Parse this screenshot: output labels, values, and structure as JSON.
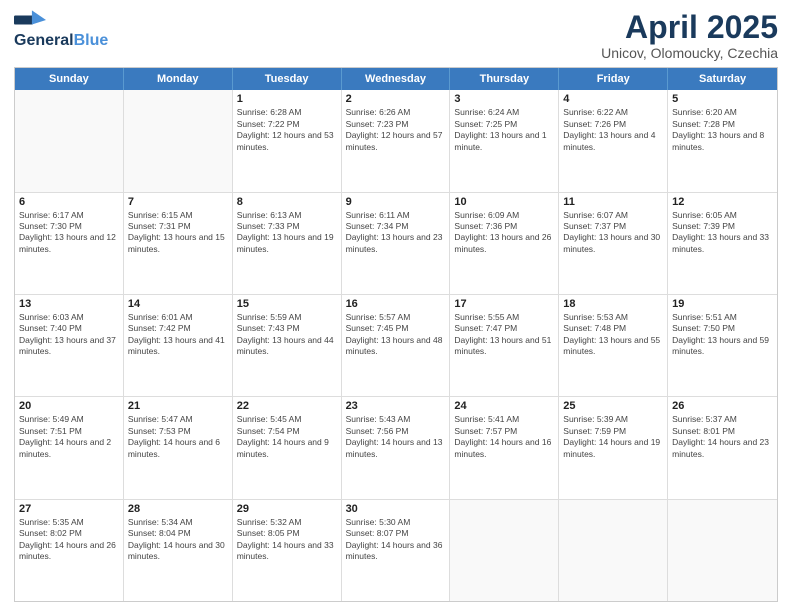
{
  "header": {
    "logo_line1": "General",
    "logo_line2": "Blue",
    "month_year": "April 2025",
    "location": "Unicov, Olomoucky, Czechia"
  },
  "days_of_week": [
    "Sunday",
    "Monday",
    "Tuesday",
    "Wednesday",
    "Thursday",
    "Friday",
    "Saturday"
  ],
  "weeks": [
    [
      {
        "day": "",
        "sunrise": "",
        "sunset": "",
        "daylight": ""
      },
      {
        "day": "",
        "sunrise": "",
        "sunset": "",
        "daylight": ""
      },
      {
        "day": "1",
        "sunrise": "Sunrise: 6:28 AM",
        "sunset": "Sunset: 7:22 PM",
        "daylight": "Daylight: 12 hours and 53 minutes."
      },
      {
        "day": "2",
        "sunrise": "Sunrise: 6:26 AM",
        "sunset": "Sunset: 7:23 PM",
        "daylight": "Daylight: 12 hours and 57 minutes."
      },
      {
        "day": "3",
        "sunrise": "Sunrise: 6:24 AM",
        "sunset": "Sunset: 7:25 PM",
        "daylight": "Daylight: 13 hours and 1 minute."
      },
      {
        "day": "4",
        "sunrise": "Sunrise: 6:22 AM",
        "sunset": "Sunset: 7:26 PM",
        "daylight": "Daylight: 13 hours and 4 minutes."
      },
      {
        "day": "5",
        "sunrise": "Sunrise: 6:20 AM",
        "sunset": "Sunset: 7:28 PM",
        "daylight": "Daylight: 13 hours and 8 minutes."
      }
    ],
    [
      {
        "day": "6",
        "sunrise": "Sunrise: 6:17 AM",
        "sunset": "Sunset: 7:30 PM",
        "daylight": "Daylight: 13 hours and 12 minutes."
      },
      {
        "day": "7",
        "sunrise": "Sunrise: 6:15 AM",
        "sunset": "Sunset: 7:31 PM",
        "daylight": "Daylight: 13 hours and 15 minutes."
      },
      {
        "day": "8",
        "sunrise": "Sunrise: 6:13 AM",
        "sunset": "Sunset: 7:33 PM",
        "daylight": "Daylight: 13 hours and 19 minutes."
      },
      {
        "day": "9",
        "sunrise": "Sunrise: 6:11 AM",
        "sunset": "Sunset: 7:34 PM",
        "daylight": "Daylight: 13 hours and 23 minutes."
      },
      {
        "day": "10",
        "sunrise": "Sunrise: 6:09 AM",
        "sunset": "Sunset: 7:36 PM",
        "daylight": "Daylight: 13 hours and 26 minutes."
      },
      {
        "day": "11",
        "sunrise": "Sunrise: 6:07 AM",
        "sunset": "Sunset: 7:37 PM",
        "daylight": "Daylight: 13 hours and 30 minutes."
      },
      {
        "day": "12",
        "sunrise": "Sunrise: 6:05 AM",
        "sunset": "Sunset: 7:39 PM",
        "daylight": "Daylight: 13 hours and 33 minutes."
      }
    ],
    [
      {
        "day": "13",
        "sunrise": "Sunrise: 6:03 AM",
        "sunset": "Sunset: 7:40 PM",
        "daylight": "Daylight: 13 hours and 37 minutes."
      },
      {
        "day": "14",
        "sunrise": "Sunrise: 6:01 AM",
        "sunset": "Sunset: 7:42 PM",
        "daylight": "Daylight: 13 hours and 41 minutes."
      },
      {
        "day": "15",
        "sunrise": "Sunrise: 5:59 AM",
        "sunset": "Sunset: 7:43 PM",
        "daylight": "Daylight: 13 hours and 44 minutes."
      },
      {
        "day": "16",
        "sunrise": "Sunrise: 5:57 AM",
        "sunset": "Sunset: 7:45 PM",
        "daylight": "Daylight: 13 hours and 48 minutes."
      },
      {
        "day": "17",
        "sunrise": "Sunrise: 5:55 AM",
        "sunset": "Sunset: 7:47 PM",
        "daylight": "Daylight: 13 hours and 51 minutes."
      },
      {
        "day": "18",
        "sunrise": "Sunrise: 5:53 AM",
        "sunset": "Sunset: 7:48 PM",
        "daylight": "Daylight: 13 hours and 55 minutes."
      },
      {
        "day": "19",
        "sunrise": "Sunrise: 5:51 AM",
        "sunset": "Sunset: 7:50 PM",
        "daylight": "Daylight: 13 hours and 59 minutes."
      }
    ],
    [
      {
        "day": "20",
        "sunrise": "Sunrise: 5:49 AM",
        "sunset": "Sunset: 7:51 PM",
        "daylight": "Daylight: 14 hours and 2 minutes."
      },
      {
        "day": "21",
        "sunrise": "Sunrise: 5:47 AM",
        "sunset": "Sunset: 7:53 PM",
        "daylight": "Daylight: 14 hours and 6 minutes."
      },
      {
        "day": "22",
        "sunrise": "Sunrise: 5:45 AM",
        "sunset": "Sunset: 7:54 PM",
        "daylight": "Daylight: 14 hours and 9 minutes."
      },
      {
        "day": "23",
        "sunrise": "Sunrise: 5:43 AM",
        "sunset": "Sunset: 7:56 PM",
        "daylight": "Daylight: 14 hours and 13 minutes."
      },
      {
        "day": "24",
        "sunrise": "Sunrise: 5:41 AM",
        "sunset": "Sunset: 7:57 PM",
        "daylight": "Daylight: 14 hours and 16 minutes."
      },
      {
        "day": "25",
        "sunrise": "Sunrise: 5:39 AM",
        "sunset": "Sunset: 7:59 PM",
        "daylight": "Daylight: 14 hours and 19 minutes."
      },
      {
        "day": "26",
        "sunrise": "Sunrise: 5:37 AM",
        "sunset": "Sunset: 8:01 PM",
        "daylight": "Daylight: 14 hours and 23 minutes."
      }
    ],
    [
      {
        "day": "27",
        "sunrise": "Sunrise: 5:35 AM",
        "sunset": "Sunset: 8:02 PM",
        "daylight": "Daylight: 14 hours and 26 minutes."
      },
      {
        "day": "28",
        "sunrise": "Sunrise: 5:34 AM",
        "sunset": "Sunset: 8:04 PM",
        "daylight": "Daylight: 14 hours and 30 minutes."
      },
      {
        "day": "29",
        "sunrise": "Sunrise: 5:32 AM",
        "sunset": "Sunset: 8:05 PM",
        "daylight": "Daylight: 14 hours and 33 minutes."
      },
      {
        "day": "30",
        "sunrise": "Sunrise: 5:30 AM",
        "sunset": "Sunset: 8:07 PM",
        "daylight": "Daylight: 14 hours and 36 minutes."
      },
      {
        "day": "",
        "sunrise": "",
        "sunset": "",
        "daylight": ""
      },
      {
        "day": "",
        "sunrise": "",
        "sunset": "",
        "daylight": ""
      },
      {
        "day": "",
        "sunrise": "",
        "sunset": "",
        "daylight": ""
      }
    ]
  ]
}
